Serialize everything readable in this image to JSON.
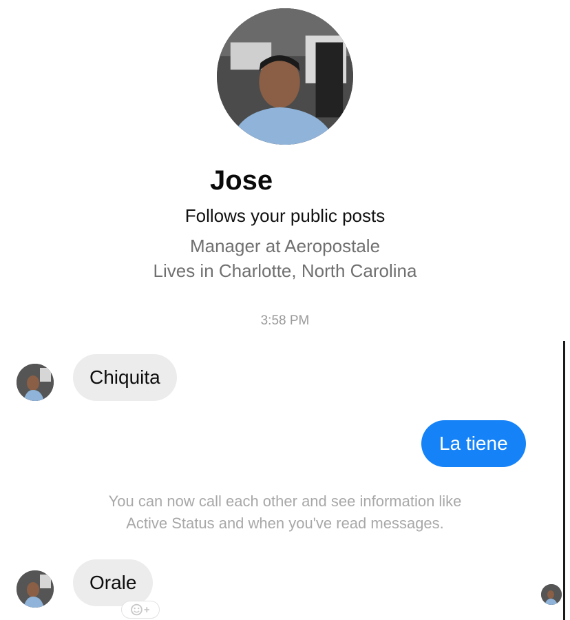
{
  "profile": {
    "name": "Jose",
    "follows": "Follows your public posts",
    "work": "Manager at Aeropostale",
    "location": "Lives in Charlotte, North Carolina"
  },
  "conversation": {
    "timestamp": "3:58 PM",
    "messages": [
      {
        "direction": "incoming",
        "text": "Chiquita"
      },
      {
        "direction": "outgoing",
        "text": "La tiene"
      },
      {
        "direction": "incoming",
        "text": "Orale"
      }
    ],
    "system_note_line1": "You can now call each other and see information like",
    "system_note_line2": "Active Status and when you've read messages."
  },
  "icons": {
    "profile_photo": "profile-photo",
    "contact_avatar": "contact-avatar",
    "read_receipt": "read-receipt-avatar",
    "reaction": "add-reaction-icon"
  },
  "colors": {
    "outgoing_bubble": "#1583f7",
    "incoming_bubble": "#ececec",
    "secondary_text": "#707070",
    "muted_text": "#a8a8a8"
  }
}
